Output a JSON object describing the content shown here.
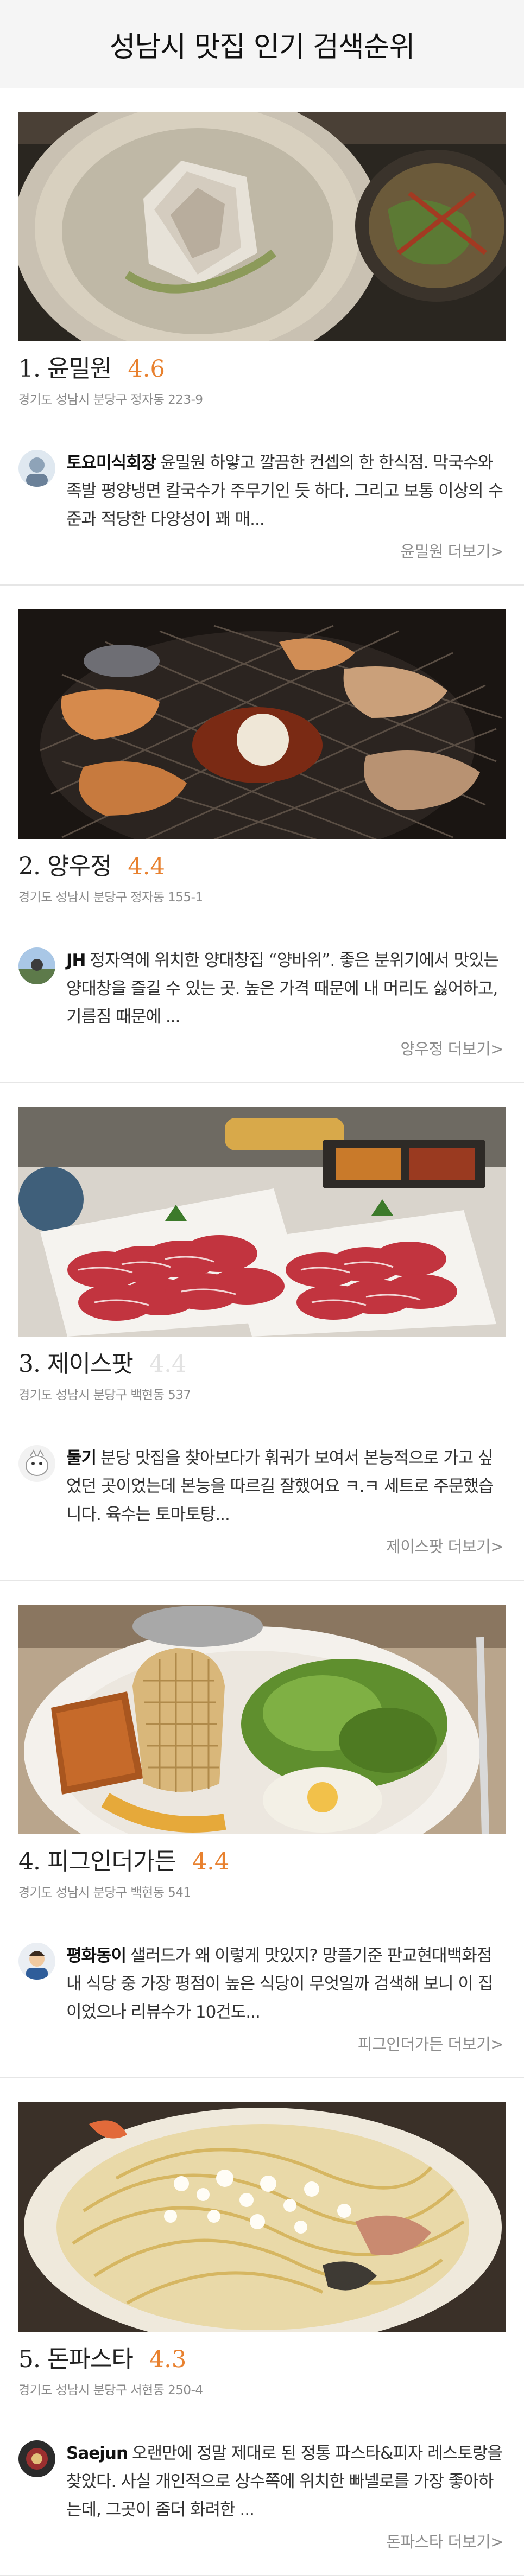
{
  "header": {
    "title": "성남시 맛집 인기 검색순위"
  },
  "restaurants": [
    {
      "rank_name": "1. 윤밀원",
      "score": "4.6",
      "address": "경기도 성남시 분당구 정자동 223-9",
      "reviewer": "토요미식회장",
      "review": "윤밀원 하얗고 깔끔한 컨셉의 한 한식점. 막국수와 족발 평양냉면 칼국수가 주무기인 듯 하다. 그리고 보통 이상의 수준과 적당한 다양성이 꽤 매...",
      "more": "윤밀원 더보기>"
    },
    {
      "rank_name": "2. 양우정",
      "score": "4.4",
      "address": "경기도 성남시 분당구 정자동 155-1",
      "reviewer": "JH",
      "review": "정자역에 위치한 양대창집 “양바위”. 좋은 분위기에서 맛있는 양대창을 즐길 수 있는 곳. 높은 가격 때문에 내 머리도 싫어하고, 기름짐 때문에 ...",
      "more": "양우정 더보기>"
    },
    {
      "rank_name": "3. 제이스팟",
      "score": "4.4",
      "address": "경기도 성남시 분당구 백현동 537",
      "reviewer": "둘기",
      "review": "분당 맛집을 찾아보다가 훠궈가 보여서 본능적으로 가고 싶었던 곳이었는데 본능을 따르길 잘했어요 ㅋ.ㅋ 세트로 주문했습니다. 육수는 토마토탕...",
      "more": "제이스팟 더보기>"
    },
    {
      "rank_name": "4. 피그인더가든",
      "score": "4.4",
      "address": "경기도 성남시 분당구 백현동 541",
      "reviewer": "평화동이",
      "review": "샐러드가 왜 이렇게 맛있지? 망플기준 판교현대백화점 내 식당 중 가장 평점이 높은 식당이 무엇일까 검색해 보니 이 집이었으나 리뷰수가 10건도...",
      "more": "피그인더가든 더보기>"
    },
    {
      "rank_name": "5. 돈파스타",
      "score": "4.3",
      "address": "경기도 성남시 분당구 서현동 250-4",
      "reviewer": "Saejun",
      "review": "오랜만에 정말 제대로 된 정통 파스타&피자 레스토랑을 찾았다. 사실 개인적으로 상수쪽에 위치한 빠넬로를 가장 좋아하는데, 그곳이 좀더 화려한 ...",
      "more": "돈파스타 더보기>"
    }
  ],
  "colors": {
    "score": "#e8812f",
    "score_faded": "#e2e2e2",
    "address": "#8a8a8a",
    "more": "#8d8d8d"
  },
  "icons": [
    "noodle-soup-photo",
    "grilled-tripe-photo",
    "beef-slices-photo",
    "salad-plate-photo",
    "pasta-photo",
    "avatar"
  ]
}
